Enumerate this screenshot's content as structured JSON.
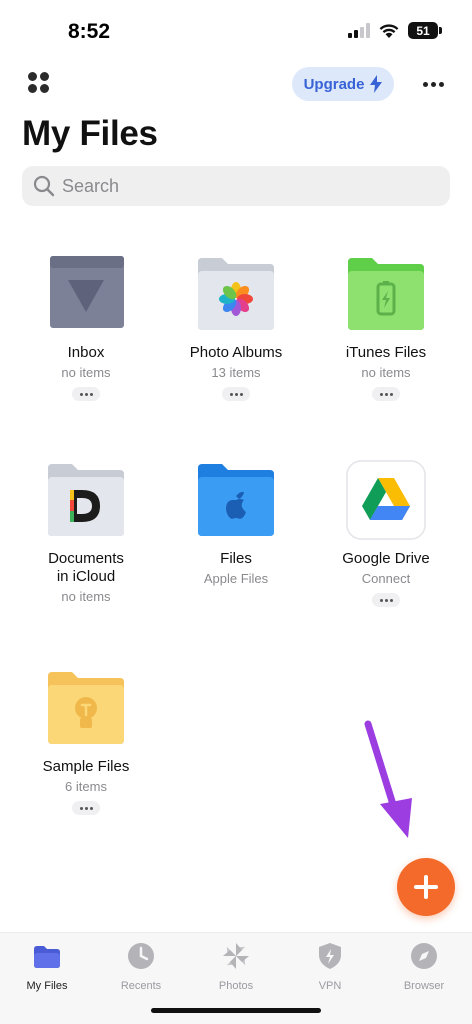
{
  "status": {
    "time": "8:52",
    "battery": "51"
  },
  "header": {
    "upgrade_label": "Upgrade",
    "title": "My Files"
  },
  "search": {
    "placeholder": "Search"
  },
  "items": [
    {
      "name": "Inbox",
      "sub": "no items"
    },
    {
      "name": "Photo Albums",
      "sub": "13 items"
    },
    {
      "name": "iTunes Files",
      "sub": "no items"
    },
    {
      "name": "Documents\nin iCloud",
      "sub": "no items"
    },
    {
      "name": "Files",
      "sub": "Apple Files"
    },
    {
      "name": "Google Drive",
      "sub": "Connect"
    },
    {
      "name": "Sample Files",
      "sub": "6 items"
    }
  ],
  "tabs": [
    {
      "label": "My Files",
      "active": true
    },
    {
      "label": "Recents"
    },
    {
      "label": "Photos"
    },
    {
      "label": "VPN"
    },
    {
      "label": "Browser"
    }
  ],
  "colors": {
    "accent": "#3763d6",
    "fab": "#f36a2a",
    "annotation_arrow": "#9b3de0"
  }
}
